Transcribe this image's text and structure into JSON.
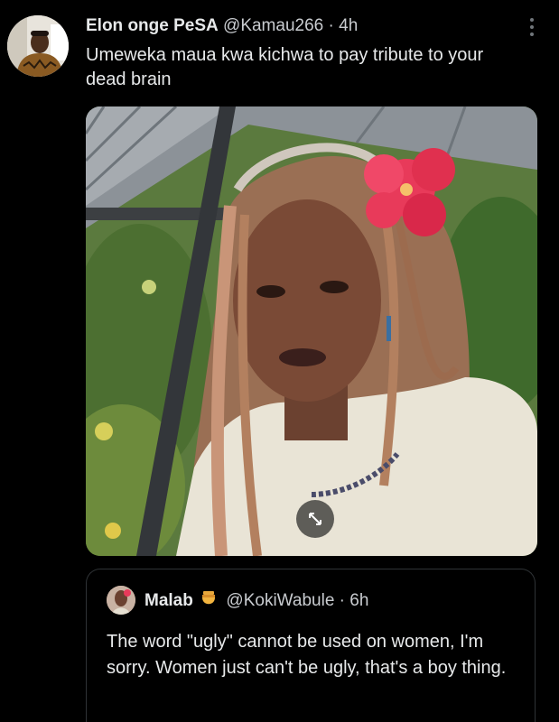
{
  "tweet": {
    "author_name": "Elon onge PeSA",
    "handle": "@Kamau266",
    "separator": "·",
    "time": "4h",
    "text": "Umeweka maua kwa kichwa to pay tribute to your dead brain",
    "more_icon": "more-vertical-icon",
    "media_expand_icon": "expand-icon"
  },
  "quote": {
    "author_name": "Malab",
    "emoji": "honey-pot-emoji",
    "handle": "@KokiWabule",
    "separator": "·",
    "time": "6h",
    "text": "The word \"ugly\" cannot be used on women, I'm sorry. Women just can't be ugly, that's a boy thing."
  },
  "colors": {
    "background": "#000000",
    "text_primary": "#e7e9ea",
    "text_secondary": "#c9ccd0",
    "border": "#2f3336",
    "flower": "#e83a5a"
  }
}
